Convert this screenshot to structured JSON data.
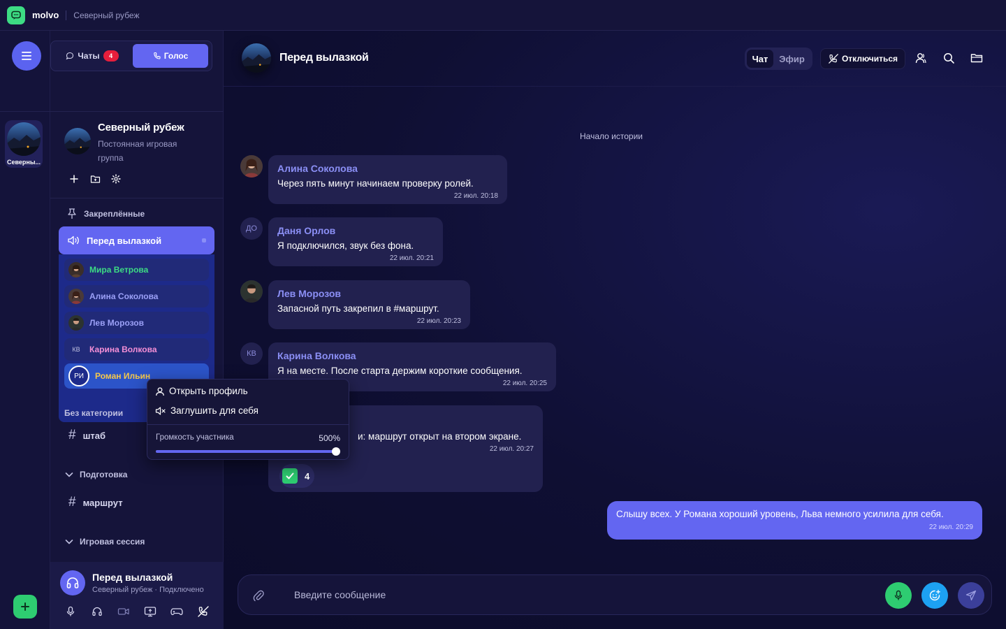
{
  "app": {
    "name": "molvo",
    "current_server": "Северный рубеж",
    "accent_color": "#6366f1"
  },
  "rail": {
    "server_label": "Северны...",
    "icons": [
      "menu-icon",
      "plus-icon"
    ]
  },
  "mode_toggle": {
    "chats_label": "Чаты",
    "chats_badge": "4",
    "voice_label": "Голос"
  },
  "server": {
    "title": "Северный рубеж",
    "description": "Постоянная игровая группа",
    "tools": [
      "plus-icon",
      "folder-plus-icon",
      "gear-icon"
    ]
  },
  "sidebar": {
    "pinned_label": "Закреплённые",
    "active_voice_channel": "Перед вылазкой",
    "members": [
      {
        "name": "Мира Ветрова",
        "color": "#3ddc84",
        "initials": ""
      },
      {
        "name": "Алина Соколова",
        "color": "#9ba0f7",
        "initials": ""
      },
      {
        "name": "Лев Морозов",
        "color": "#9ba0f7",
        "initials": ""
      },
      {
        "name": "Карина Волкова",
        "color": "#f48fd6",
        "initials": "КВ"
      },
      {
        "name": "Роман Ильин",
        "color": "#f5c84c",
        "initials": "РИ"
      }
    ],
    "categories": [
      {
        "label": "Без категории",
        "channels": [
          "штаб"
        ]
      },
      {
        "label": "Подготовка",
        "channels": [
          "маршрут"
        ]
      },
      {
        "label": "Игровая сессия",
        "channels": []
      }
    ]
  },
  "voice_status": {
    "title": "Перед вылазкой",
    "subtitle": "Северный рубеж · Подключено"
  },
  "channel_header": {
    "title": "Перед вылазкой",
    "view_chat": "Чат",
    "view_air": "Эфир",
    "disconnect_label": "Отключиться",
    "icons": [
      "user-icon",
      "search-icon",
      "folder-icon"
    ]
  },
  "chat": {
    "history_start": "Начало истории",
    "messages": [
      {
        "author": "Алина Соколова",
        "text": "Через пять минут начинаем проверку ролей.",
        "time": "22 июл. 20:18",
        "initials": ""
      },
      {
        "author": "Даня Орлов",
        "text": "Я подключился, звук без фона.",
        "time": "22 июл. 20:21",
        "initials": "ДО"
      },
      {
        "author": "Лев Морозов",
        "text": "Запасной путь закрепил в #маршрут.",
        "time": "22 июл. 20:23",
        "initials": ""
      },
      {
        "author": "Карина Волкова",
        "text": "Я на месте. После старта держим короткие сообщения.",
        "time": "22 июл. 20:25",
        "initials": "КВ"
      },
      {
        "author": "",
        "text": "и: маршрут открыт на втором экране.",
        "time": "22 июл. 20:27",
        "initials": ""
      }
    ],
    "reaction": {
      "icon": "check-icon",
      "count": "4"
    },
    "own_message": {
      "text": "Слышу всех. У Романа хороший уровень, Льва немного усилила для себя.",
      "time": "22 июл. 20:29"
    }
  },
  "composer": {
    "placeholder": "Введите сообщение"
  },
  "context_menu": {
    "open_profile": "Открыть профиль",
    "mute_for_me": "Заглушить для себя",
    "volume_label": "Громкость участника",
    "volume_value": "500%",
    "volume_fraction": 1.0
  }
}
